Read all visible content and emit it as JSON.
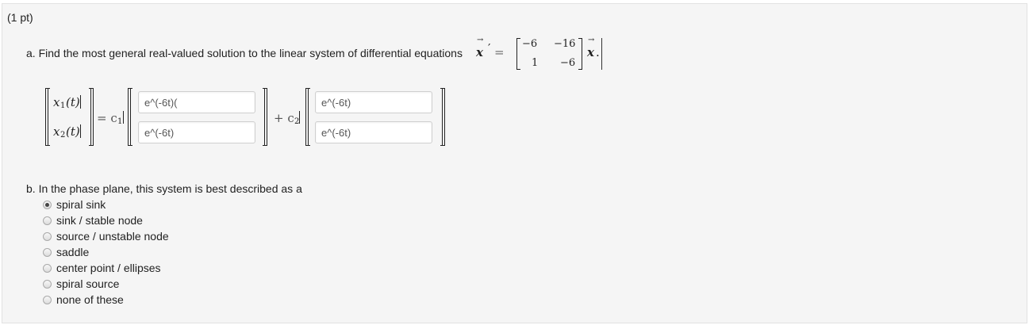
{
  "points": "(1 pt)",
  "part_a": {
    "prompt": "a. Find the most general real-valued solution to the linear system of differential equations",
    "vec": "x",
    "prime": "′",
    "equals": "=",
    "matrix": [
      "−6",
      "−16",
      "1",
      "−6"
    ],
    "trailing_vec": "x",
    "period": "."
  },
  "solution": {
    "x1": "x",
    "x1_sub": "1",
    "x1_arg": "(t)",
    "x2": "x",
    "x2_sub": "2",
    "x2_arg": "(t)",
    "eq_c1": "= c",
    "c1_sub": "1",
    "plus_c2": "+ c",
    "c2_sub": "2",
    "fields": {
      "c1_top": "e^(-6t)(",
      "c1_bottom": "e^(-6t)",
      "c2_top": "e^(-6t)",
      "c2_bottom": "e^(-6t)"
    }
  },
  "part_b": {
    "prompt": "b. In the phase plane, this system is best described as a",
    "selected_index": 0,
    "options": [
      "spiral sink",
      "sink / stable node",
      "source / unstable node",
      "saddle",
      "center point / ellipses",
      "spiral source",
      "none of these"
    ]
  }
}
